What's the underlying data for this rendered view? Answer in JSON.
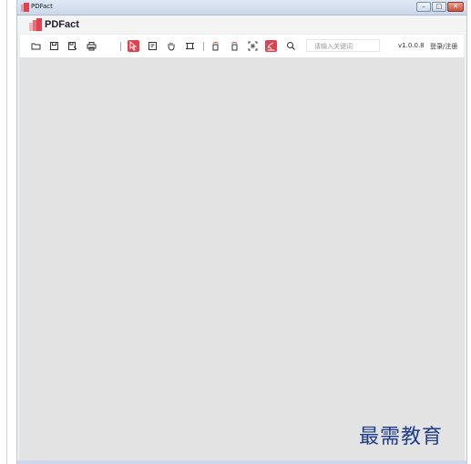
{
  "window": {
    "title": "PDFact",
    "minimize_glyph": "–",
    "maximize_glyph": "□",
    "close_glyph": "✕"
  },
  "header": {
    "app_name": "PDFact"
  },
  "toolbar": {
    "search_placeholder": "请输入关键词",
    "version": "v1.0.0.8",
    "login_label": "登录/注册",
    "tools": [
      {
        "name": "open-folder-icon",
        "active": false
      },
      {
        "name": "save-icon",
        "active": false
      },
      {
        "name": "save-as-icon",
        "active": false
      },
      {
        "name": "print-icon",
        "active": false
      },
      {
        "name": "select-cursor-icon",
        "active": true
      },
      {
        "name": "text-select-icon",
        "active": false
      },
      {
        "name": "hand-pan-icon",
        "active": false
      },
      {
        "name": "crop-icon",
        "active": false
      },
      {
        "name": "rotate-left-icon",
        "active": false
      },
      {
        "name": "rotate-right-icon",
        "active": false
      },
      {
        "name": "fit-page-icon",
        "active": false
      },
      {
        "name": "sign-icon",
        "active": true
      },
      {
        "name": "search-icon",
        "active": false
      }
    ]
  },
  "colors": {
    "accent": "#e0424f",
    "workspace": "#e3e3e3"
  },
  "watermark": {
    "text": "最需教育"
  }
}
